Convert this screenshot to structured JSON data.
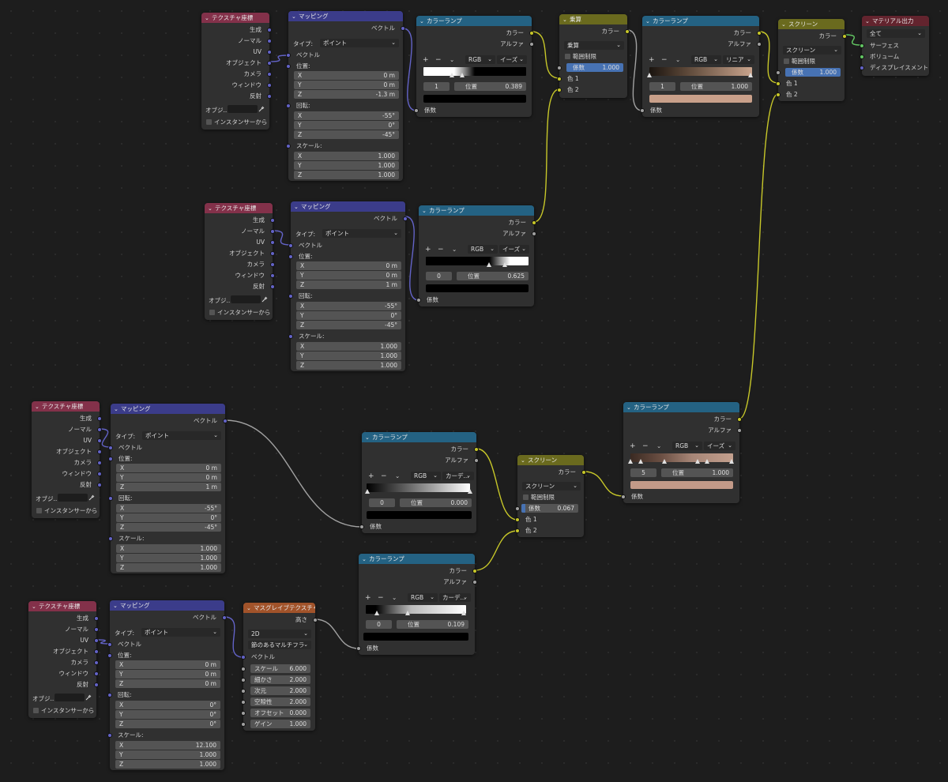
{
  "colors": {
    "vector": "#6363c7",
    "color": "#c7c729",
    "float": "#a1a1a1",
    "shader": "#63c763"
  },
  "icons": {
    "collapse": "chevron-down-icon",
    "eyedropper": "eyedropper-icon",
    "add": "plus-icon",
    "remove": "minus-icon",
    "menu": "chevron-down-icon"
  },
  "texcoord": {
    "title": "テクスチャ座標",
    "outputs": [
      "生成",
      "ノーマル",
      "UV",
      "オブジェクト",
      "カメラ",
      "ウィンドウ",
      "反射"
    ],
    "object_label": "オブジ...",
    "instancer": "インスタンサーから"
  },
  "mapping": {
    "title": "マッピング",
    "vector_out": "ベクトル",
    "type_label": "タイプ:",
    "type_value": "ポイント",
    "vector_in": "ベクトル",
    "loc_label": "位置:",
    "rot_label": "回転:",
    "scale_label": "スケール:",
    "axes": [
      "X",
      "Y",
      "Z"
    ]
  },
  "ramp": {
    "title": "カラーランプ",
    "out_color": "カラー",
    "out_alpha": "アルファ",
    "in_fac": "係数",
    "mode_rgb": "RGB",
    "pos_label": "位置",
    "add": "+",
    "remove": "−"
  },
  "mix": {
    "color_out": "カラー",
    "range_clamp": "範囲制限",
    "fac": "係数",
    "color1": "色 1",
    "color2": "色 2"
  },
  "nodes": {
    "m1": {
      "loc": [
        "0 m",
        "0 m",
        "-1.3 m"
      ],
      "rot": [
        "-55°",
        "0°",
        "-45°"
      ],
      "scale": [
        "1.000",
        "1.000",
        "1.000"
      ]
    },
    "m2": {
      "loc": [
        "0 m",
        "0 m",
        "1 m"
      ],
      "rot": [
        "-55°",
        "0°",
        "-45°"
      ],
      "scale": [
        "1.000",
        "1.000",
        "1.000"
      ]
    },
    "m3": {
      "loc": [
        "0 m",
        "0 m",
        "1 m"
      ],
      "rot": [
        "-55°",
        "0°",
        "-45°"
      ],
      "scale": [
        "1.000",
        "1.000",
        "1.000"
      ]
    },
    "m4": {
      "loc": [
        "0 m",
        "0 m",
        "0 m"
      ],
      "rot": [
        "0°",
        "0°",
        "0°"
      ],
      "scale": [
        "12.100",
        "1.000",
        "1.000"
      ]
    },
    "r1": {
      "interp": "イーズ",
      "index": "1",
      "pos": "0.389"
    },
    "r2": {
      "interp": "イーズ",
      "index": "0",
      "pos": "0.625"
    },
    "r3": {
      "interp": "カーデ...",
      "index": "0",
      "pos": "0.000"
    },
    "r4": {
      "interp": "カーデ...",
      "index": "0",
      "pos": "0.109"
    },
    "r5": {
      "interp": "リニア",
      "index": "1",
      "pos": "1.000"
    },
    "r6": {
      "interp": "イーズ",
      "index": "5",
      "pos": "1.000"
    },
    "multiply": {
      "title": "乗算",
      "op": "乗算",
      "fac": "1.000"
    },
    "screen1": {
      "title": "スクリーン",
      "op": "スクリーン",
      "fac": "1.000"
    },
    "screen2": {
      "title": "スクリーン",
      "op": "スクリーン",
      "fac": "0.067"
    },
    "musgrave": {
      "title": "マスグレイブテクスチャ",
      "height_out": "高さ",
      "dim": "2D",
      "kind": "節のあるマルチフラク...",
      "vector_in": "ベクトル",
      "params": [
        [
          "スケール",
          "6.000"
        ],
        [
          "細かさ",
          "2.000"
        ],
        [
          "次元",
          "2.000"
        ],
        [
          "空隙性",
          "2.000"
        ],
        [
          "オフセット",
          "0.000"
        ],
        [
          "ゲイン",
          "1.000"
        ]
      ]
    },
    "output": {
      "title": "マテリアル出力",
      "target": "全て",
      "inputs": [
        "サーフェス",
        "ボリューム",
        "ディスプレイスメント"
      ]
    }
  }
}
